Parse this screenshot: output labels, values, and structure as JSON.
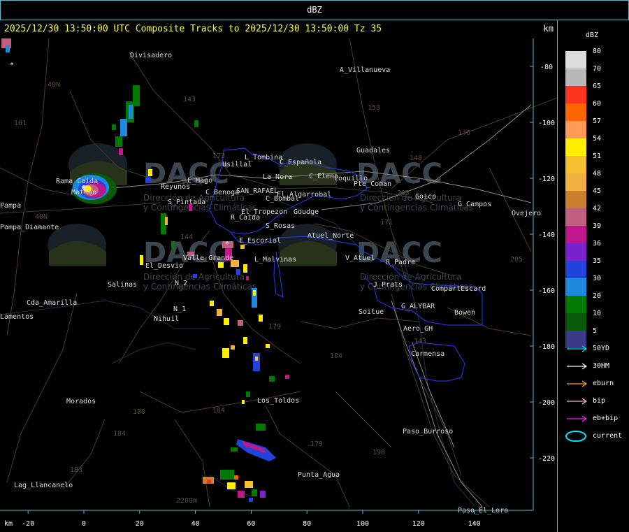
{
  "window_title": "dBZ",
  "header": {
    "title": "2025/12/30 13:50:00 UTC Composite Tracks to 2025/12/30 13:50:00 Tz 35",
    "units": "km"
  },
  "legend": {
    "title": "dBZ",
    "levels": [
      {
        "value": "80",
        "color": "#dcdcdc"
      },
      {
        "value": "70",
        "color": "#b8b8b8"
      },
      {
        "value": "65",
        "color": "#ff3320"
      },
      {
        "value": "60",
        "color": "#ff6600"
      },
      {
        "value": "57",
        "color": "#ff9955"
      },
      {
        "value": "54",
        "color": "#ffee00"
      },
      {
        "value": "51",
        "color": "#f5c030"
      },
      {
        "value": "48",
        "color": "#f0b040"
      },
      {
        "value": "45",
        "color": "#c88030"
      },
      {
        "value": "42",
        "color": "#c06080"
      },
      {
        "value": "39",
        "color": "#c0188c"
      },
      {
        "value": "36",
        "color": "#7a22cc"
      },
      {
        "value": "35",
        "color": "#2244dd"
      },
      {
        "value": "30",
        "color": "#1e88dd"
      },
      {
        "value": "20",
        "color": "#007a00"
      },
      {
        "value": "10",
        "color": "#0a5a0a"
      },
      {
        "value": "5",
        "color": "#3a3a88"
      }
    ],
    "tracks": [
      {
        "label": "50YD",
        "color": "#00e5ff"
      },
      {
        "label": "30HM",
        "color": "#ffffff"
      },
      {
        "label": "eburn",
        "color": "#ffaa22"
      },
      {
        "label": "bip",
        "color": "#ffbbdd"
      },
      {
        "label": "eb+bip",
        "color": "#ff22ff"
      },
      {
        "label": "current",
        "color": "#00e5ff"
      }
    ]
  },
  "axes": {
    "x_unit": "km",
    "x_ticks": [
      "-20",
      "0",
      "20",
      "40",
      "60",
      "80",
      "100",
      "120",
      "140"
    ],
    "y_ticks": [
      "-80",
      "-100",
      "-120",
      "-140",
      "-160",
      "-180",
      "-200",
      "-220"
    ]
  },
  "places": [
    {
      "name": "Divisadero"
    },
    {
      "name": "A_Villanueva"
    },
    {
      "name": "Guadales"
    },
    {
      "name": "Usillal"
    },
    {
      "name": "L_Tombina"
    },
    {
      "name": "C_Española"
    },
    {
      "name": "La_Nora"
    },
    {
      "name": "C_Elena"
    },
    {
      "name": "Loquillo"
    },
    {
      "name": "Pte_Coman"
    },
    {
      "name": "Goico"
    },
    {
      "name": "G_Campos"
    },
    {
      "name": "Ovejero"
    },
    {
      "name": "Rama Caida"
    },
    {
      "name": "Reyunos"
    },
    {
      "name": "E_Mago"
    },
    {
      "name": "C_Benoga"
    },
    {
      "name": "SAN_RAFAEL"
    },
    {
      "name": "El_Algarrobal"
    },
    {
      "name": "C_Bombal"
    },
    {
      "name": "Mathon"
    },
    {
      "name": "Pampa_Diamante"
    },
    {
      "name": "S_Pintada"
    },
    {
      "name": "El_Tropezon"
    },
    {
      "name": "Goudge"
    },
    {
      "name": "R_Caida"
    },
    {
      "name": "S_Rosas"
    },
    {
      "name": "Atuel_Norte"
    },
    {
      "name": "E_Escorial"
    },
    {
      "name": "Valle_Grande"
    },
    {
      "name": "L_Malvinas"
    },
    {
      "name": "V_Atuel"
    },
    {
      "name": "R_Padre"
    },
    {
      "name": "El_Desvio"
    },
    {
      "name": "Salinas"
    },
    {
      "name": "N_2"
    },
    {
      "name": "J_Prats"
    },
    {
      "name": "CompartEscard"
    },
    {
      "name": "Cda_Amarilla"
    },
    {
      "name": "N_1"
    },
    {
      "name": "Nihuil"
    },
    {
      "name": "G_ALYBAR"
    },
    {
      "name": "Soitue"
    },
    {
      "name": "Bowen"
    },
    {
      "name": "Aero_GH"
    },
    {
      "name": "Carmensa"
    },
    {
      "name": "Morados"
    },
    {
      "name": "Los_Toldos"
    },
    {
      "name": "Paso_Burroso"
    },
    {
      "name": "Punta_Agua"
    },
    {
      "name": "Lag_Llancanelo"
    },
    {
      "name": "Paso_El_Loro"
    },
    {
      "name": "Lamentos"
    },
    {
      "name": "Pampa"
    }
  ],
  "route_numbers": [
    "143",
    "153",
    "146",
    "148",
    "203",
    "171",
    "173",
    "101",
    "40N",
    "144",
    "40N",
    "180",
    "184",
    "179",
    "184",
    "190",
    "184",
    "179",
    "183",
    "143",
    "2200m",
    "205"
  ],
  "watermark": {
    "brand": "DACC",
    "line1": "Dirección de Agricultura",
    "line2": "y Contingencias Climáticas"
  }
}
